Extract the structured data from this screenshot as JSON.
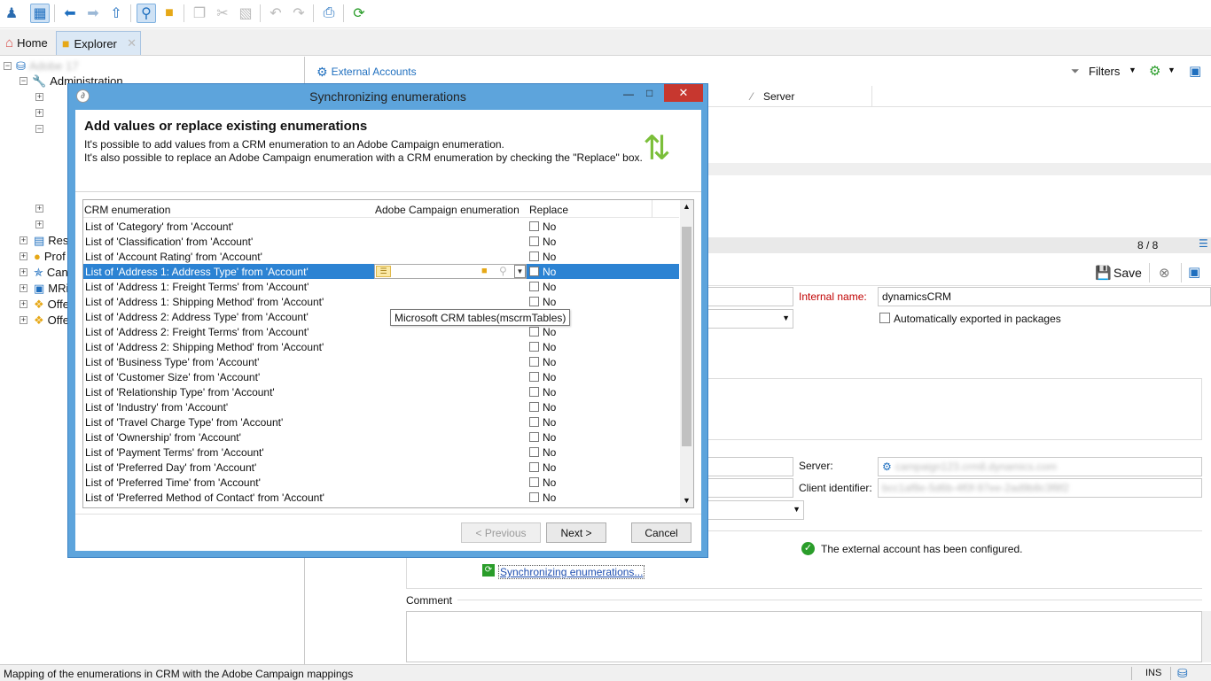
{
  "toolbar": {
    "icons": [
      "new-user-icon",
      "explorer-view-icon",
      "back-icon",
      "forward-icon",
      "up-folder-icon",
      "search-folder-icon",
      "open-folder-icon",
      "copy-icon",
      "cut-icon",
      "paste-icon",
      "undo-icon",
      "redo-icon",
      "print-icon",
      "refresh-icon"
    ]
  },
  "tabs": {
    "home": "Home",
    "explorer": "Explorer"
  },
  "tree": {
    "root": "Adobe 17",
    "administration": "Administration",
    "items": [
      "Res",
      "Prof",
      "Can",
      "MRi",
      "Offe",
      "Offe"
    ]
  },
  "external_accounts": {
    "title": "External Accounts",
    "filters": "Filters",
    "col_server": "Server",
    "count": "8 / 8"
  },
  "form": {
    "save": "Save",
    "internal_name_label": "Internal name:",
    "internal_name_value": "dynamicsCRM",
    "auto_export_label": "Automatically exported in packages",
    "server_label": "Server:",
    "server_value": "campaign123.crm8.dynamics.com",
    "client_id_label": "Client identifier:",
    "client_id_value": "bcc1af8e-5d6b-4f0f-97ee-2ad9b8c3f8f2",
    "configured": "The external account has been configured.",
    "sync_link": "Synchronizing enumerations...",
    "comment_label": "Comment"
  },
  "status": {
    "text": "Mapping of the enumerations in CRM with the Adobe Campaign mappings",
    "ins": "INS"
  },
  "dialog": {
    "title": "Synchronizing enumerations",
    "heading": "Add values or replace existing enumerations",
    "desc1": "It's possible to add values from a CRM enumeration to an Adobe Campaign enumeration.",
    "desc2": "It's also possible to replace an Adobe Campaign enumeration with a CRM enumeration by checking the \"Replace\" box.",
    "col_crm": "CRM enumeration",
    "col_ac": "Adobe Campaign enumeration",
    "col_replace": "Replace",
    "rows": [
      "List of 'Category' from 'Account'",
      "List of 'Classification' from 'Account'",
      "List of 'Account Rating' from 'Account'",
      "List of 'Address 1: Address Type' from 'Account'",
      "List of 'Address 1: Freight Terms' from 'Account'",
      "List of 'Address 1: Shipping Method' from 'Account'",
      "List of 'Address 2: Address Type' from 'Account'",
      "List of 'Address 2: Freight Terms' from 'Account'",
      "List of 'Address 2: Shipping Method' from 'Account'",
      "List of 'Business Type' from 'Account'",
      "List of 'Customer Size' from 'Account'",
      "List of 'Relationship Type' from 'Account'",
      "List of 'Industry' from 'Account'",
      "List of 'Travel Charge Type' from 'Account'",
      "List of 'Ownership' from 'Account'",
      "List of 'Payment Terms' from 'Account'",
      "List of 'Preferred Day' from 'Account'",
      "List of 'Preferred Time' from 'Account'",
      "List of 'Preferred Method of Contact' from 'Account'"
    ],
    "replace_value": "No",
    "tooltip": "Microsoft CRM tables(mscrmTables)",
    "btn_previous": "< Previous",
    "btn_next": "Next >",
    "btn_cancel": "Cancel"
  }
}
